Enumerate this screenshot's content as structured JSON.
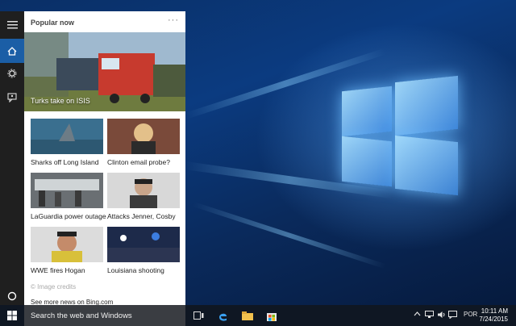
{
  "cortana": {
    "section_title": "Popular now",
    "more_label": "···",
    "hero": {
      "caption": "Turks take on ISIS"
    },
    "tiles": [
      {
        "caption": "Sharks off Long Island"
      },
      {
        "caption": "Clinton email probe?"
      },
      {
        "caption": "LaGuardia power outage"
      },
      {
        "caption": "Attacks Jenner, Cosby"
      },
      {
        "caption": "WWE fires Hogan"
      },
      {
        "caption": "Louisiana shooting"
      }
    ],
    "credits": "© Image credits",
    "more_news": "See more news on Bing.com"
  },
  "taskbar": {
    "search_placeholder": "Search the web and Windows",
    "language": "POR",
    "time": "10:11 AM",
    "date": "7/24/2015"
  },
  "colors": {
    "rail": "#1f1f1f",
    "rail_active": "#1b5ea6",
    "taskbar": "#0f1723",
    "searchbox": "#3a3d42"
  }
}
